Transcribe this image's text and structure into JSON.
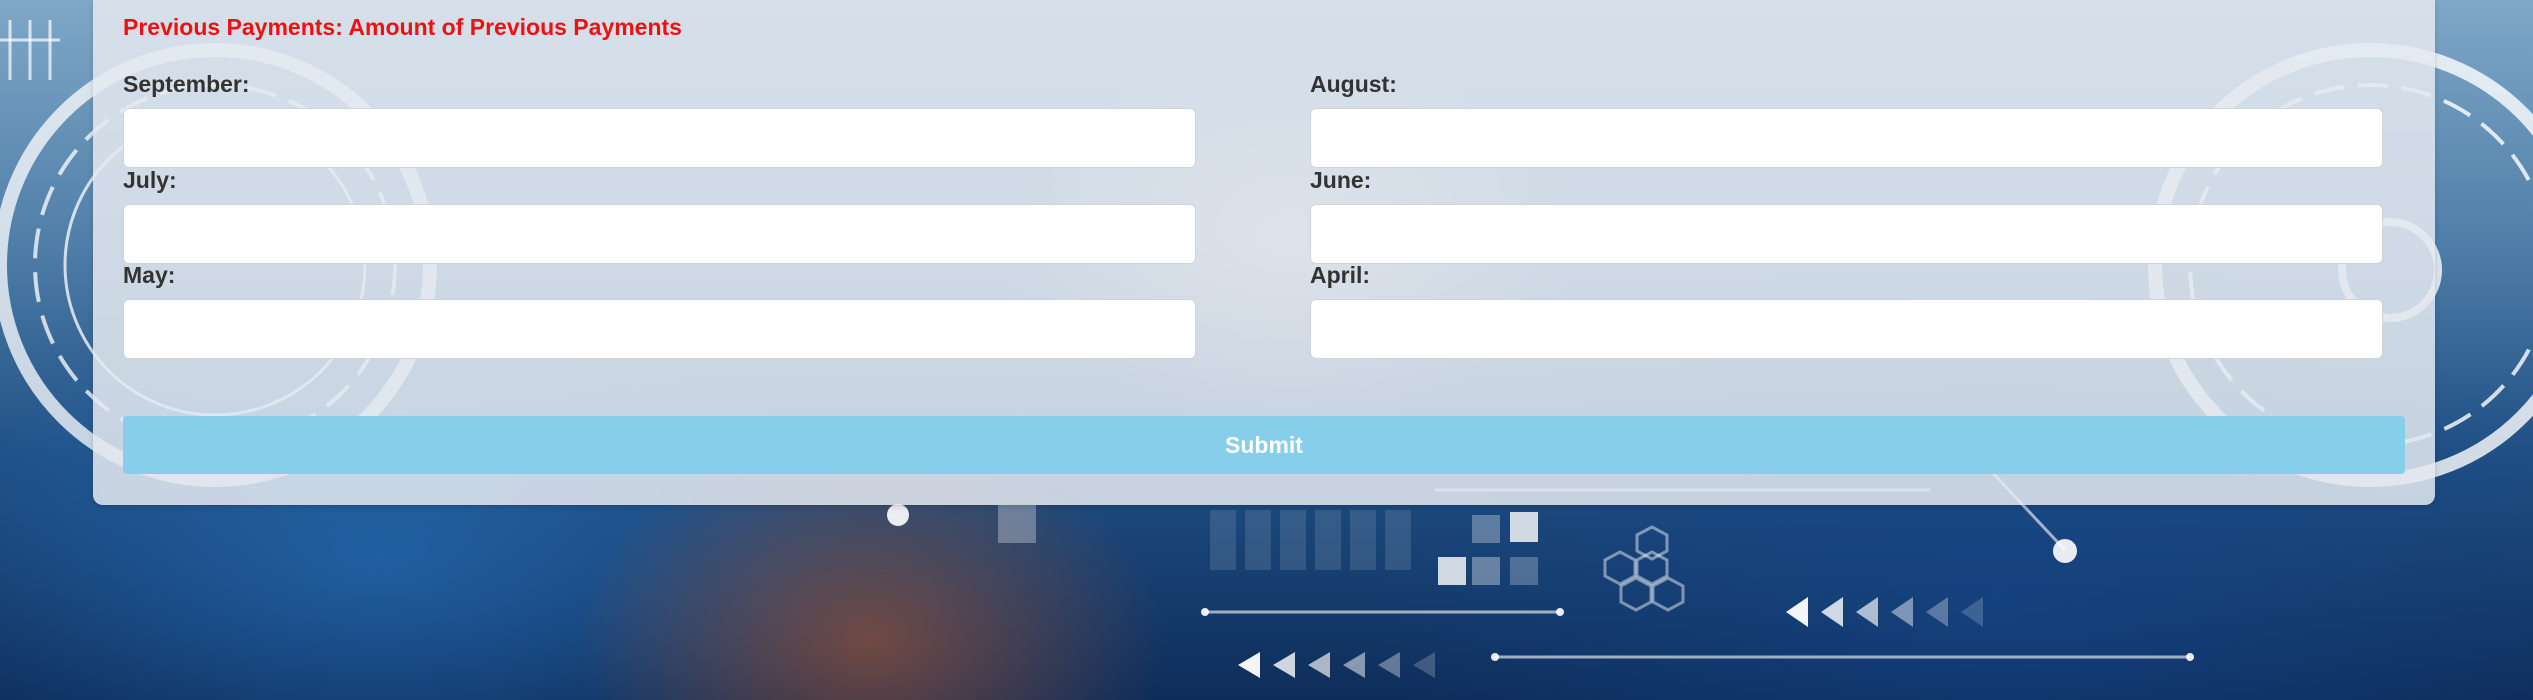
{
  "form": {
    "section_title": "Previous Payments: Amount of Previous Payments",
    "fields": [
      {
        "label": "September:",
        "value": "",
        "placeholder": ""
      },
      {
        "label": "August:",
        "value": "",
        "placeholder": ""
      },
      {
        "label": "July:",
        "value": "",
        "placeholder": ""
      },
      {
        "label": "June:",
        "value": "",
        "placeholder": ""
      },
      {
        "label": "May:",
        "value": "",
        "placeholder": ""
      },
      {
        "label": "April:",
        "value": "",
        "placeholder": ""
      }
    ],
    "submit_label": "Submit"
  },
  "colors": {
    "title": "#ee1111",
    "label": "#333333",
    "submit_background": "#87ceeb",
    "submit_text": "#ffffff"
  }
}
